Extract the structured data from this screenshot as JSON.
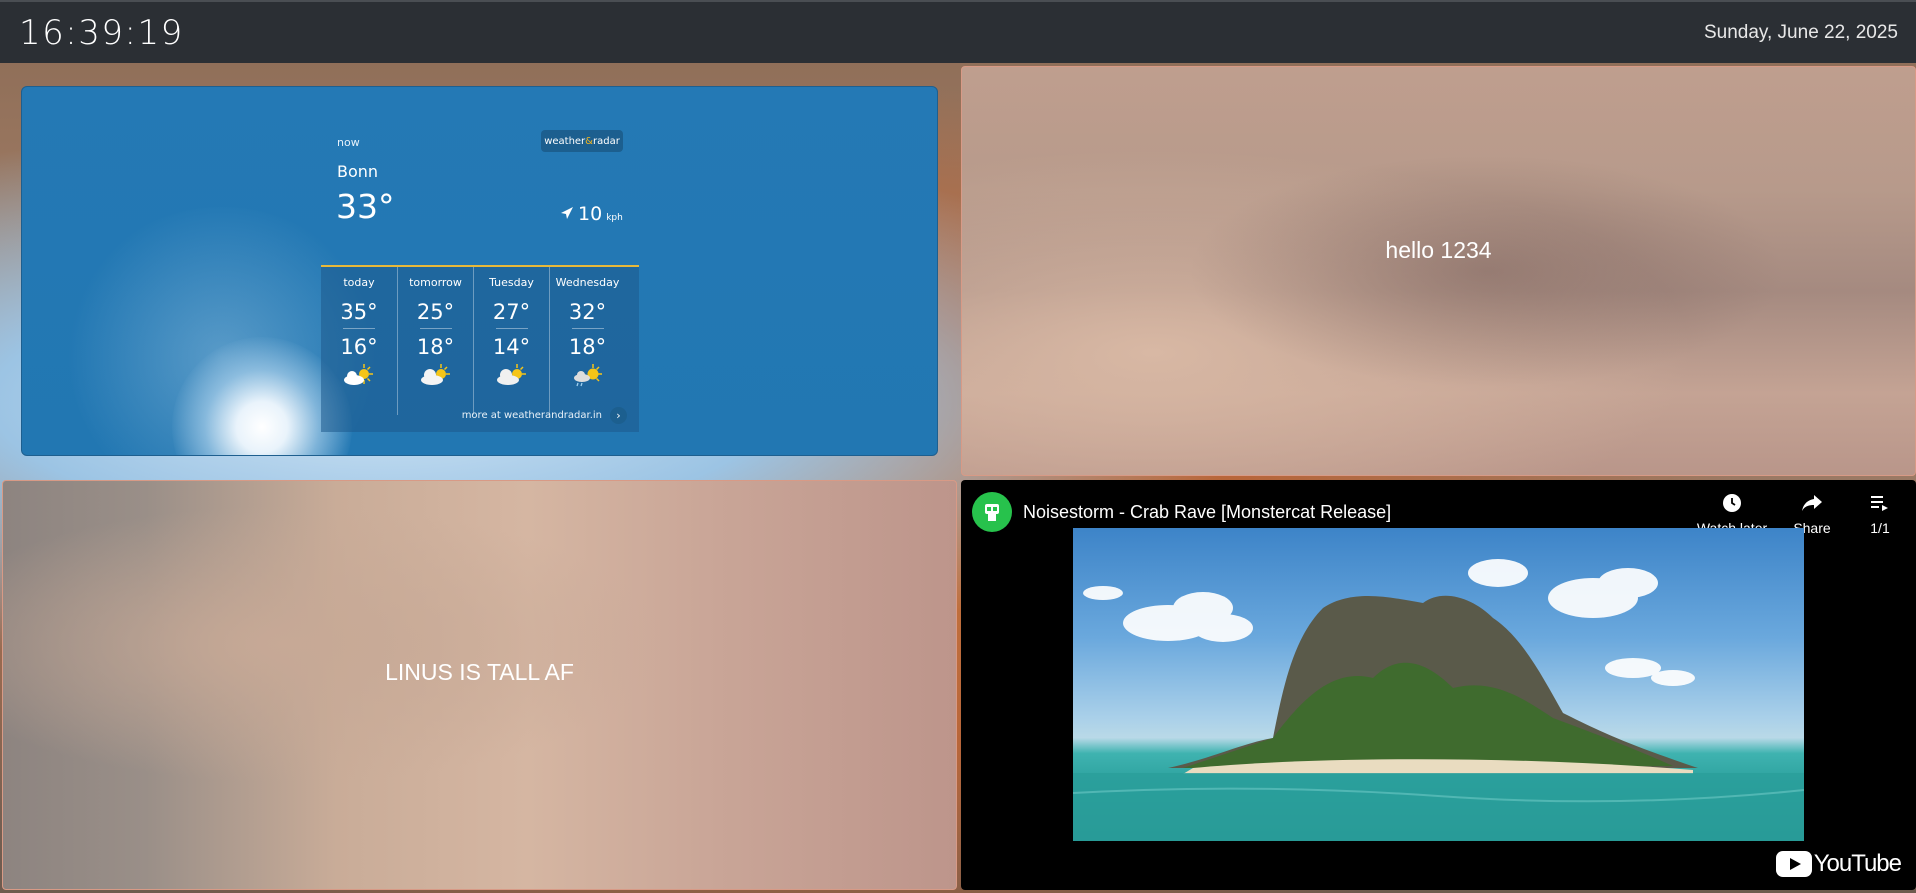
{
  "header": {
    "clock": "16:39:19",
    "date": "Sunday, June 22, 2025"
  },
  "weather": {
    "now_label": "now",
    "brand": {
      "left": "weather",
      "amp": "&",
      "right": "radar"
    },
    "city": "Bonn",
    "temperature": "33°",
    "wind_value": "10",
    "wind_unit": "kph",
    "forecast": [
      {
        "day": "today",
        "high": "35°",
        "low": "16°",
        "icon": "partly-sunny-icon"
      },
      {
        "day": "tomorrow",
        "high": "25°",
        "low": "18°",
        "icon": "partly-sunny-icon"
      },
      {
        "day": "Tuesday",
        "high": "27°",
        "low": "14°",
        "icon": "partly-sunny-icon"
      },
      {
        "day": "Wednesday",
        "high": "32°",
        "low": "18°",
        "icon": "rain-sun-icon"
      }
    ],
    "more_link": "more at weatherandradar.in"
  },
  "notes": {
    "top_right": "hello 1234",
    "bottom_left": "LINUS IS TALL AF"
  },
  "youtube": {
    "title": "Noisestorm - Crab Rave [Monstercat Release]",
    "watch_later": "Watch later",
    "share": "Share",
    "playlist_count": "1/1",
    "logo": "YouTube"
  }
}
